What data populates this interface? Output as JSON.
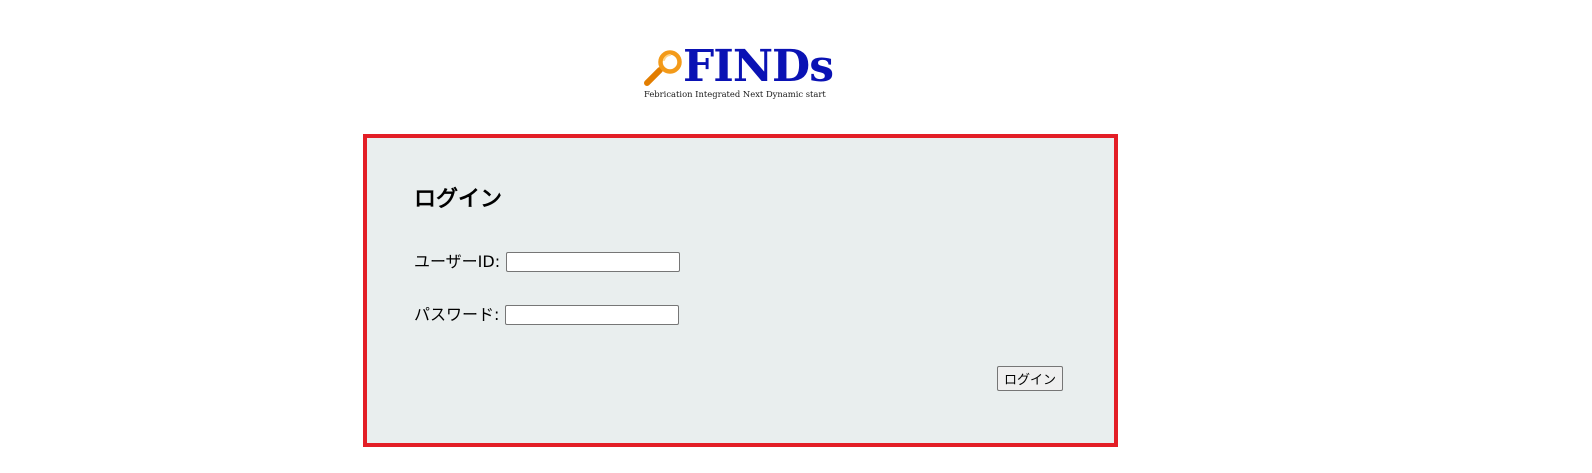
{
  "logo": {
    "name": "FINDs",
    "tagline": "Febrication Integrated Next Dynamic start",
    "icon": "magnifying-glass-icon",
    "colors": {
      "word": "#0a12b4",
      "icon": "#f39a19"
    }
  },
  "login": {
    "title": "ログイン",
    "user_id_label": "ユーザーID:",
    "user_id_value": "",
    "password_label": "パスワード:",
    "password_value": "",
    "submit_label": "ログイン",
    "colors": {
      "panel_background": "#e9eeee",
      "panel_border": "#e31e26"
    }
  }
}
